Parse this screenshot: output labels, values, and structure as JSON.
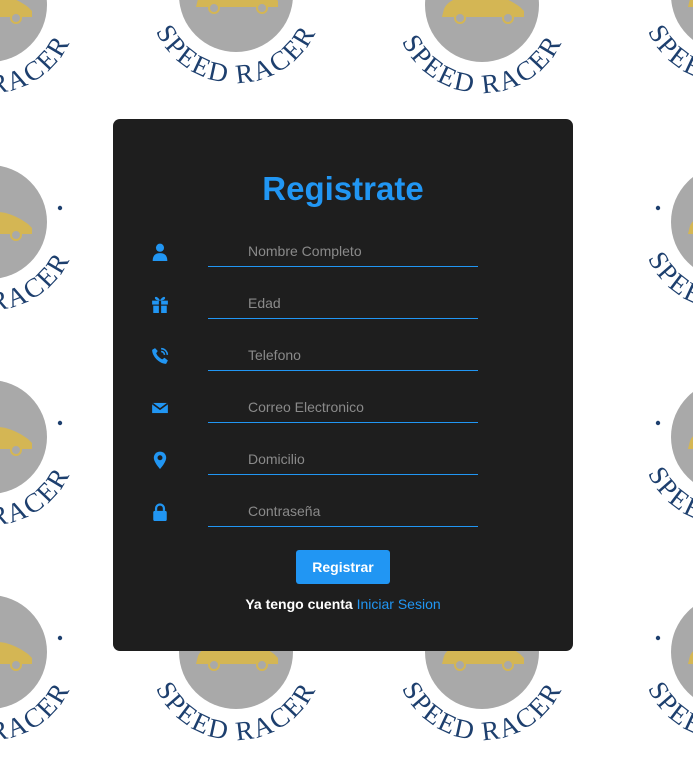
{
  "background": {
    "logo_text": "SPEED RACER",
    "colors": {
      "page": "#ffffff",
      "circle": "#a9a9a9",
      "car": "#d4b654",
      "text": "#1d3f6e"
    }
  },
  "form": {
    "title": "Registrate",
    "fields": [
      {
        "icon": "user-icon",
        "placeholder": "Nombre Completo",
        "value": ""
      },
      {
        "icon": "gift-icon",
        "placeholder": "Edad",
        "value": ""
      },
      {
        "icon": "phone-icon",
        "placeholder": "Telefono",
        "value": ""
      },
      {
        "icon": "envelope-icon",
        "placeholder": "Correo Electronico",
        "value": ""
      },
      {
        "icon": "location-pin-icon",
        "placeholder": "Domicilio",
        "value": ""
      },
      {
        "icon": "lock-icon",
        "placeholder": "Contraseña",
        "value": ""
      }
    ],
    "submit_label": "Registrar",
    "login_prompt": "Ya tengo cuenta",
    "login_link": "Iniciar Sesion",
    "colors": {
      "card": "#1e1e1e",
      "accent": "#2196f3",
      "placeholder": "#8a8a8a",
      "text": "#ffffff"
    }
  }
}
